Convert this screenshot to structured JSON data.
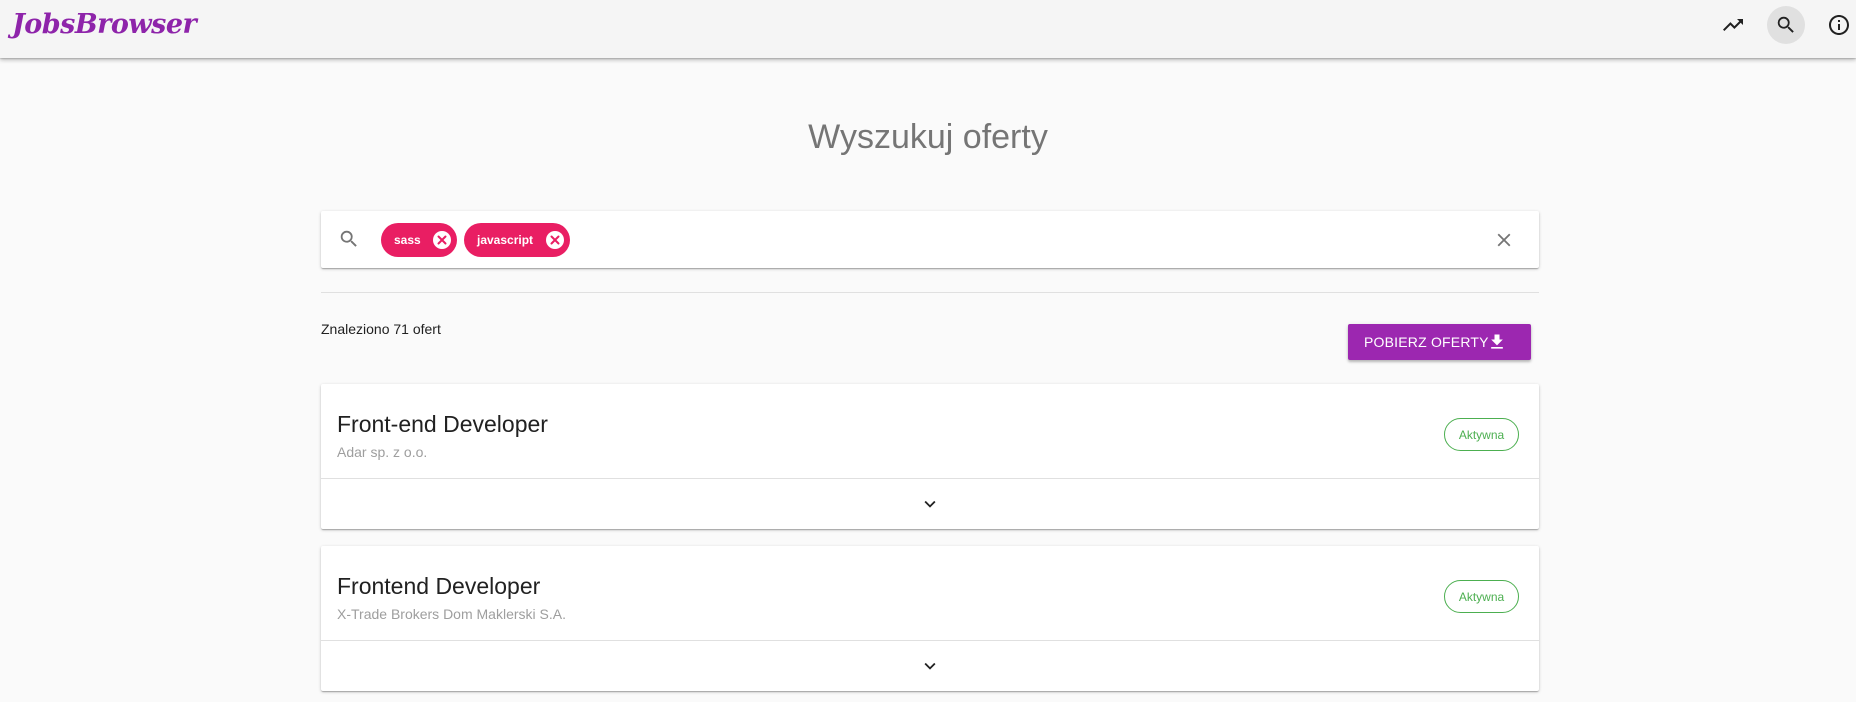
{
  "app": {
    "logo": "JobsBrowser"
  },
  "appbar": {
    "icons": [
      "trending-up-icon",
      "search-icon",
      "info-icon"
    ],
    "active_icon": "search-icon"
  },
  "page": {
    "title": "Wyszukuj oferty"
  },
  "search": {
    "chips": [
      {
        "label": "sass"
      },
      {
        "label": "javascript"
      }
    ],
    "chip_color": "#e91e63"
  },
  "results": {
    "count_text": "Znaleziono 71 ofert",
    "download_label": "POBIERZ OFERTY"
  },
  "jobs": [
    {
      "title": "Front-end Developer",
      "company": "Adar sp. z o.o.",
      "status": "Aktywna"
    },
    {
      "title": "Frontend Developer",
      "company": "X-Trade Brokers Dom Maklerski S.A.",
      "status": "Aktywna"
    }
  ],
  "colors": {
    "brand": "#8e24aa",
    "button": "#9c27b0",
    "status_active": "#4caf50"
  }
}
